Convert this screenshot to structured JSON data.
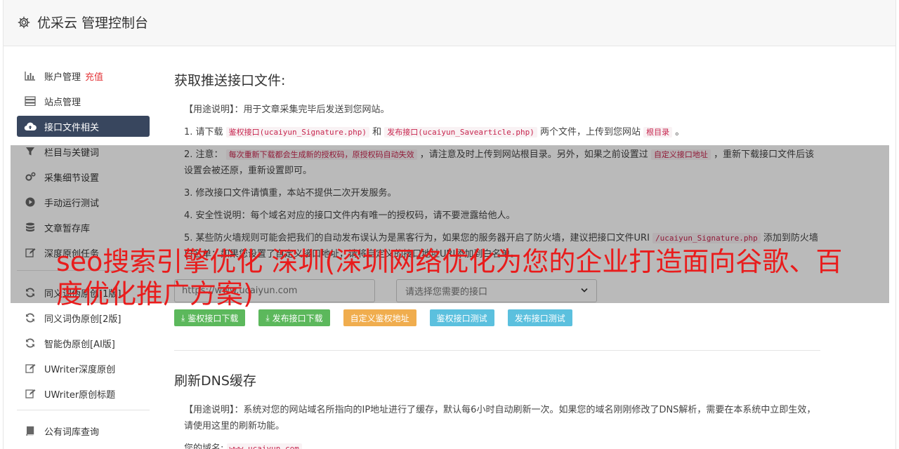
{
  "header": {
    "title": "优采云 管理控制台",
    "icon": "gear-icon"
  },
  "sidebar": {
    "recharge_label": "充值",
    "items": [
      {
        "label": "账户管理",
        "icon": "bar-chart-icon"
      },
      {
        "label": "站点管理",
        "icon": "server-icon"
      },
      {
        "label": "接口文件相关",
        "icon": "cloud-upload-icon",
        "active": true
      },
      {
        "label": "栏目与关键词",
        "icon": "filter-icon"
      },
      {
        "label": "采集细节设置",
        "icon": "cogs-icon"
      },
      {
        "label": "手动运行测试",
        "icon": "play-circle-icon"
      },
      {
        "label": "文章暂存库",
        "icon": "database-icon"
      },
      {
        "label": "深度原创任务",
        "icon": "edit-icon"
      },
      {
        "label": "同义词伪原创[1版]",
        "icon": "refresh-icon"
      },
      {
        "label": "同义词伪原创[2版]",
        "icon": "refresh-icon"
      },
      {
        "label": "智能伪原创[AI版]",
        "icon": "refresh-icon"
      },
      {
        "label": "UWriter深度原创",
        "icon": "edit-icon"
      },
      {
        "label": "UWriter原创标题",
        "icon": "edit-icon"
      },
      {
        "label": "公有词库查询",
        "icon": "book-icon"
      }
    ]
  },
  "section1": {
    "title": "获取推送接口文件:",
    "usage": "【用途说明】：用于文章采集完毕后发送到您网站。",
    "item1": {
      "prefix": "1. 请下载 ",
      "code1": "鉴权接口(ucaiyun_Signature.php)",
      "mid": " 和 ",
      "code2": "发布接口(ucaiyun_Savearticle.php)",
      "mid2": " 两个文件，上传到您网站 ",
      "code3": "根目录",
      "suffix": " 。"
    },
    "item2": {
      "prefix": "2. 注意： ",
      "code1": "每次重新下载都会生成新的授权码，原授权码自动失效",
      "mid": " ，请注意及时上传到网站根目录。另外，如果之前设置过 ",
      "code2": "自定义接口地址",
      "suffix": " ，重新下载接口文件后该设置会被还原，重新设置即可。"
    },
    "item3": "3. 修改接口文件请慎重，本站不提供二次开发服务。",
    "item4": "4. 安全性说明：每个域名对应的接口文件内有唯一的授权码，请不要泄露给他人。",
    "item5": {
      "prefix": "5. 某些防火墙规则可能会把我们的自动发布误认为是黑客行为，如果您的服务器开启了防火墙，建议把接口文件URI ",
      "code1": "/ucaiyun_Signature.php",
      "suffix": " 添加到防火墙白名单；如果您设置了自定义接口地址，请将自定义的接口地址URI添加到白名单。"
    },
    "url_placeholder": "https://www.ucaiyun.com",
    "select_placeholder": "请选择您需要的接口",
    "buttons": {
      "sign_download": "鉴权接口下载",
      "publish_download": "发布接口下载",
      "custom_url": "自定义鉴权地址",
      "sign_test": "鉴权接口测试",
      "publish_test": "发布接口测试"
    }
  },
  "section2": {
    "title": "刷新DNS缓存",
    "usage": "【用途说明】：系统对您的网站域名所指向的IP地址进行了缓存，默认每6小时自动刷新一次。如果您的域名刚刚修改了DNS解析，需要在本系统中立即生效，请使用这里的刷新功能。",
    "domain_label": "您的域名:",
    "domain_value": "www.ucaiyun.com"
  },
  "overlay_text": "seo搜索引擎优化 深圳(深圳网络优化为您的企业打造面向谷歌、百度优化推广方案)"
}
